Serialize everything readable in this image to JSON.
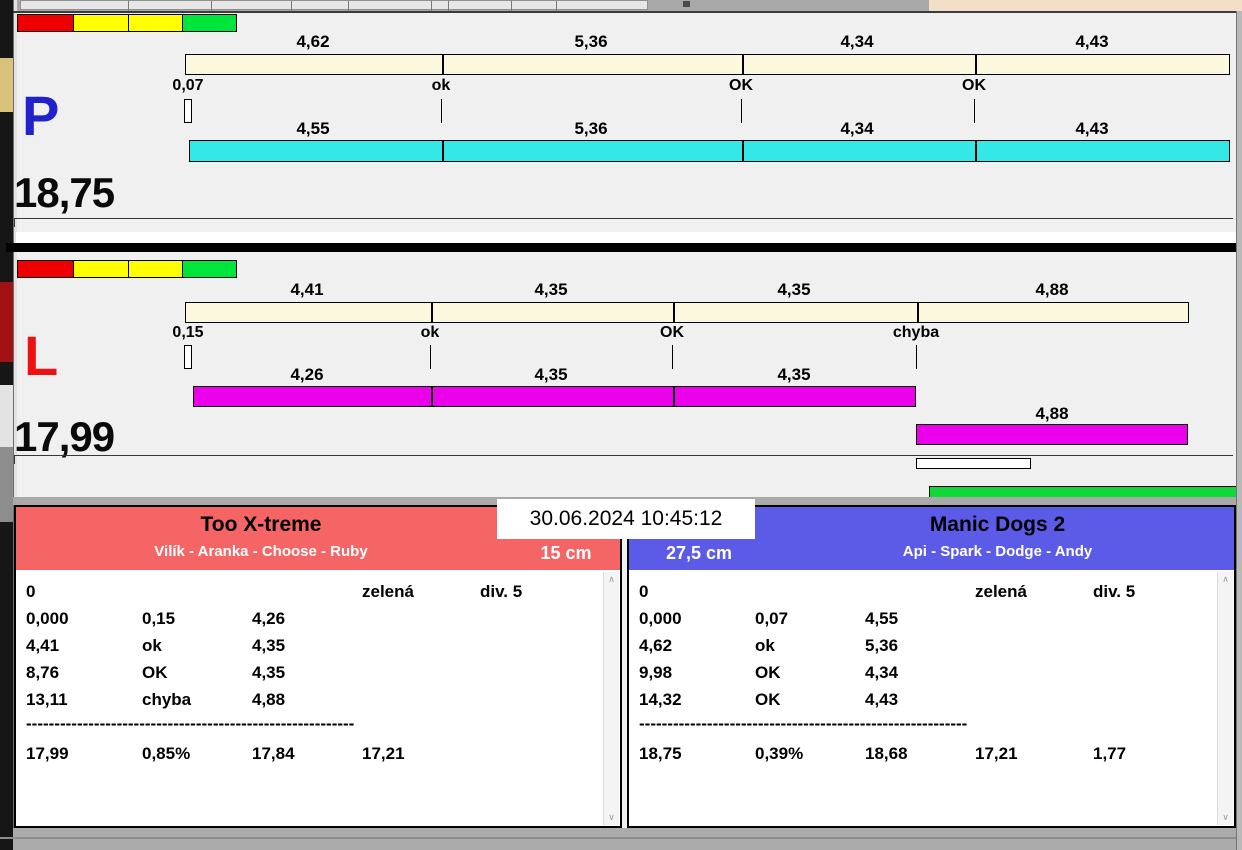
{
  "datetime": "30.06.2024 10:45:12",
  "icons": {
    "scroll_up": "∧",
    "scroll_down": "∨"
  },
  "colors": {
    "accent-left": "#f56565",
    "accent-right": "#5b5be8",
    "bar-ref": "#fbf8de",
    "bar-p": "#35e8e8",
    "bar-l": "#ea00ea",
    "bar-green": "#10d838",
    "legend-red": "#ee0000",
    "legend-yellow": "#ffff00",
    "legend-green": "#00e53c",
    "letter-p": "#2222cc",
    "letter-l": "#ee1111"
  },
  "lane_p": {
    "letter": "P",
    "total": "18,75",
    "ref_labels": [
      "4,62",
      "5,36",
      "4,34",
      "4,43"
    ],
    "tick_labels": [
      "0,07",
      "ok",
      "OK",
      "OK"
    ],
    "run_labels": [
      "4,55",
      "5,36",
      "4,34",
      "4,43"
    ]
  },
  "lane_l": {
    "letter": "L",
    "total": "17,99",
    "ref_labels": [
      "4,41",
      "4,35",
      "4,35",
      "4,88"
    ],
    "tick_labels": [
      "0,15",
      "ok",
      "OK",
      "chyba"
    ],
    "run_labels": [
      "4,26",
      "4,35",
      "4,35"
    ],
    "run2_label": "4,88"
  },
  "teams": {
    "left": {
      "name": "Too X-treme",
      "members": "Vilík - Aranka - Choose - Ruby",
      "height": "15 cm",
      "rows": [
        [
          "0",
          "",
          "",
          "zelená",
          "div. 5"
        ],
        [
          "0,000",
          "0,15",
          "4,26",
          "",
          ""
        ],
        [
          "4,41",
          "ok",
          "4,35",
          "",
          ""
        ],
        [
          "8,76",
          "OK",
          "4,35",
          "",
          ""
        ],
        [
          "13,11",
          "chyba",
          "4,88",
          "",
          ""
        ]
      ],
      "separator": "----------------------------------------------------------",
      "summary": [
        "17,99",
        "0,85%",
        "17,84",
        "17,21",
        ""
      ]
    },
    "right": {
      "name": "Manic Dogs 2",
      "members": "Api - Spark - Dodge - Andy",
      "height": "27,5 cm",
      "rows": [
        [
          "0",
          "",
          "",
          "zelená",
          "div. 5"
        ],
        [
          "0,000",
          "0,07",
          "4,55",
          "",
          ""
        ],
        [
          "4,62",
          "ok",
          "5,36",
          "",
          ""
        ],
        [
          "9,98",
          "OK",
          "4,34",
          "",
          ""
        ],
        [
          "14,32",
          "OK",
          "4,43",
          "",
          ""
        ]
      ],
      "separator": "----------------------------------------------------------",
      "summary": [
        "18,75",
        "0,39%",
        "18,68",
        "17,21",
        "1,77"
      ]
    }
  }
}
